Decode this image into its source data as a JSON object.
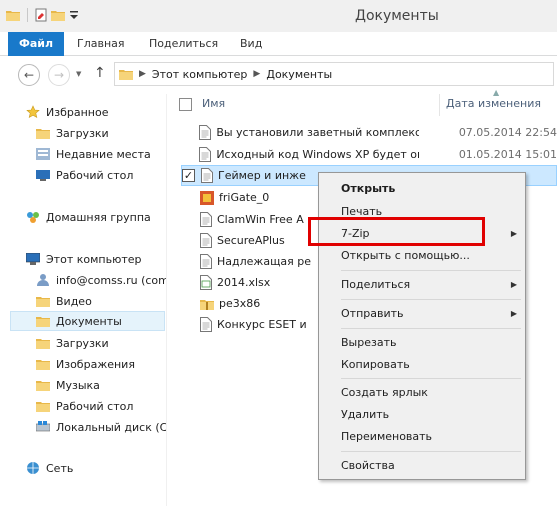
{
  "window": {
    "title": "Документы"
  },
  "ribbon": {
    "tabs": [
      "Файл",
      "Главная",
      "Поделиться",
      "Вид"
    ]
  },
  "address": {
    "path": [
      "Этот компьютер",
      "Документы"
    ]
  },
  "navpane": {
    "items": [
      {
        "label": "Избранное",
        "icon": "star-icon"
      },
      {
        "label": "Загрузки",
        "icon": "folder-icon"
      },
      {
        "label": "Недавние места",
        "icon": "recent-places-icon"
      },
      {
        "label": "Рабочий стол",
        "icon": "desktop-icon"
      },
      {
        "label": "Домашняя группа",
        "icon": "homegroup-icon"
      },
      {
        "label": "Этот компьютер",
        "icon": "computer-icon"
      },
      {
        "label": "info@comss.ru (com",
        "icon": "user-icon"
      },
      {
        "label": "Видео",
        "icon": "folder-icon"
      },
      {
        "label": "Документы",
        "icon": "folder-icon"
      },
      {
        "label": "Загрузки",
        "icon": "folder-icon"
      },
      {
        "label": "Изображения",
        "icon": "folder-icon"
      },
      {
        "label": "Музыка",
        "icon": "folder-icon"
      },
      {
        "label": "Рабочий стол",
        "icon": "folder-icon"
      },
      {
        "label": "Локальный диск (С",
        "icon": "drive-icon"
      },
      {
        "label": "Сеть",
        "icon": "network-icon"
      }
    ]
  },
  "filelist": {
    "columns": {
      "name": "Имя",
      "date": "Дата изменения"
    },
    "rows": [
      {
        "name": "Вы установили заветный комплекс ...",
        "date": "07.05.2014 22:54",
        "icon": "document-icon"
      },
      {
        "name": "Исходный код Windows XP будет оп...",
        "date": "01.05.2014 15:01",
        "icon": "document-icon"
      },
      {
        "name": "Геймер и инже",
        "date": "",
        "icon": "document-icon",
        "checked": "✓"
      },
      {
        "name": "friGate_0",
        "date": "",
        "icon": "image-icon"
      },
      {
        "name": "ClamWin Free A",
        "date": "",
        "icon": "document-icon"
      },
      {
        "name": "SecureAPlus",
        "date": "",
        "icon": "document-icon"
      },
      {
        "name": "Надлежащая ре",
        "date": "",
        "icon": "document-icon"
      },
      {
        "name": "2014.xlsx",
        "date": "",
        "icon": "spreadsheet-icon"
      },
      {
        "name": "pe3x86",
        "date": "",
        "icon": "zip-folder-icon"
      },
      {
        "name": "Конкурс ESET и",
        "date": "",
        "icon": "document-icon"
      }
    ]
  },
  "context_menu": {
    "items": [
      "Открыть",
      "Печать",
      "7-Zip",
      "Открыть с помощью...",
      "Поделиться",
      "Отправить",
      "Вырезать",
      "Копировать",
      "Создать ярлык",
      "Удалить",
      "Переименовать",
      "Свойства"
    ],
    "submenu_arrow": "▶"
  },
  "colors": {
    "accent": "#1979ca",
    "selection": "#cce8ff",
    "highlight_box": "#e00000"
  }
}
